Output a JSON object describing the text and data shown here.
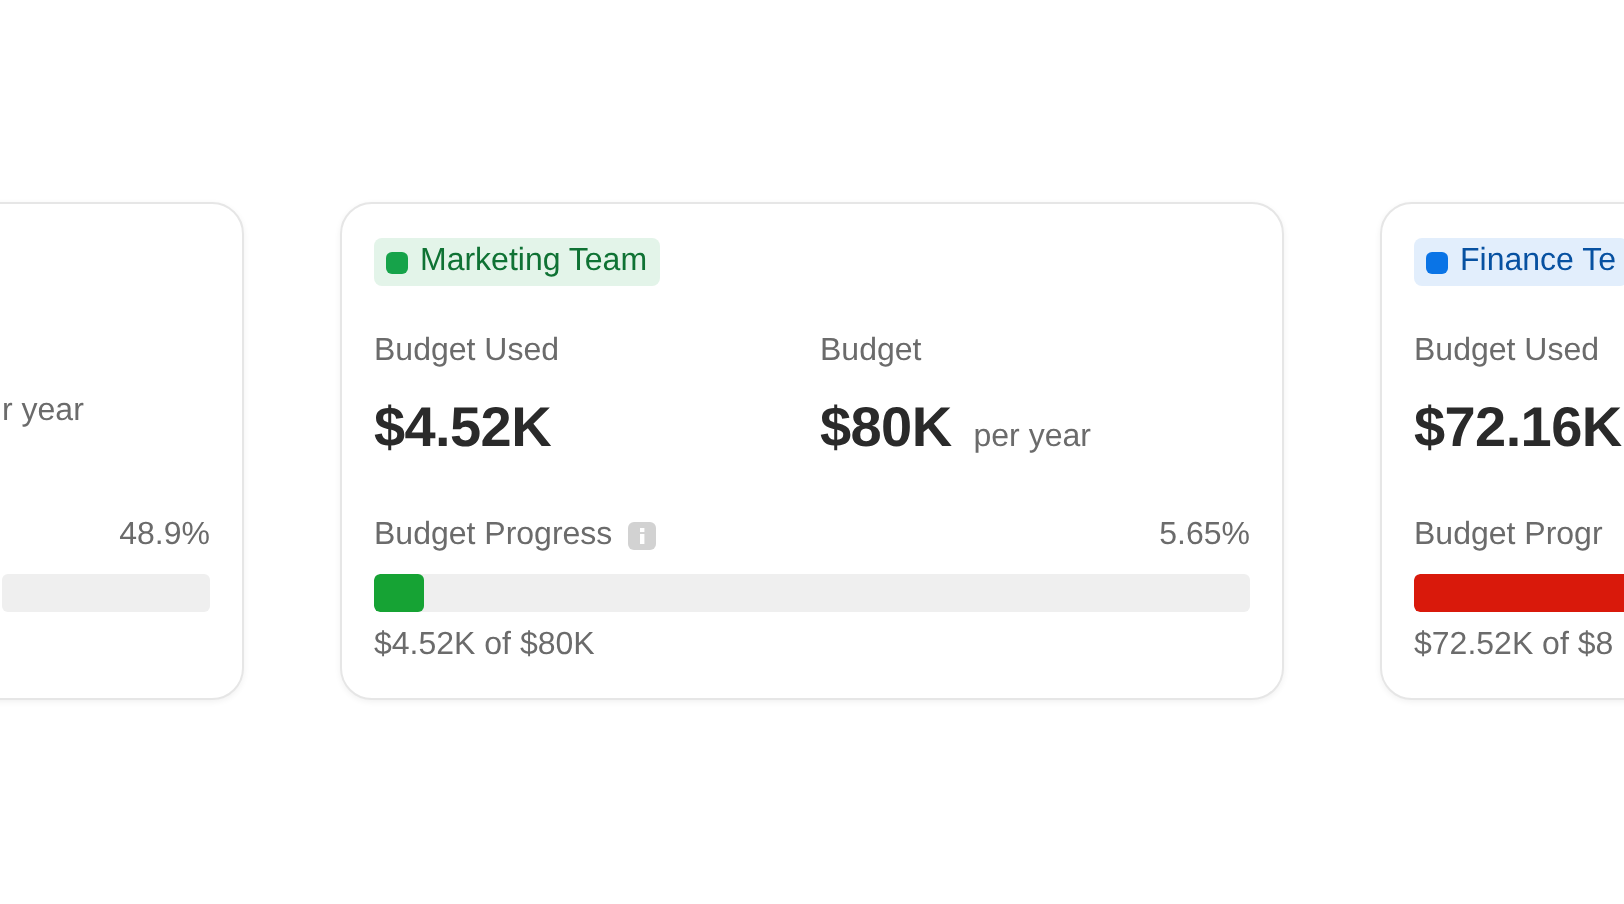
{
  "cards": [
    {
      "budget_suffix": "r year",
      "percent": "48.9%"
    },
    {
      "team": {
        "name": "Marketing Team",
        "color": "#16a34a"
      },
      "used_label": "Budget Used",
      "used": "$4.52K",
      "budget_label": "Budget",
      "budget": "$80K",
      "budget_suffix": "per year",
      "progress_label": "Budget Progress",
      "info": true,
      "percent": "5.65%",
      "level": 0.0565,
      "color": "#16a334",
      "summary": "$4.52K of $80K"
    },
    {
      "team": {
        "name": "Finance Te",
        "color": "#0a74e6"
      },
      "used_label": "Budget Used",
      "used": "$72.16K",
      "progress_label": "Budget Progr",
      "level": 0.902,
      "color": "#d9190b",
      "summary": "$72.52K of $8"
    }
  ]
}
